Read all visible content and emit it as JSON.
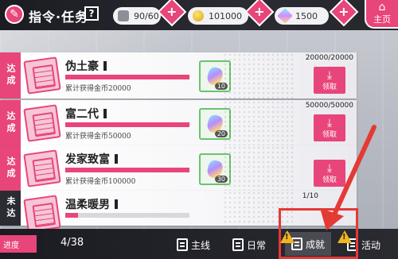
{
  "header": {
    "title": "指令·任务",
    "help_label": "?",
    "resources": {
      "stamina": "90/60",
      "coins": "101000",
      "crystals": "1500"
    },
    "plus_label": "+",
    "home_label": "主页"
  },
  "tasks": [
    {
      "status": "达成",
      "name": "伪土豪",
      "desc": "累计获得金币20000",
      "count": "20000/20000",
      "progress": 1.0,
      "reward_qty": "10",
      "claim_label": "领取"
    },
    {
      "status": "达成",
      "name": "富二代",
      "desc": "累计获得金币50000",
      "count": "50000/50000",
      "progress": 1.0,
      "reward_qty": "20",
      "claim_label": "领取"
    },
    {
      "status": "达成",
      "name": "发家致富",
      "desc": "累计获得金币100000",
      "count": "",
      "progress": 1.0,
      "reward_qty": "30",
      "claim_label": "领取"
    },
    {
      "status": "未达",
      "name": "温柔暖男",
      "desc": "",
      "count": "1/10",
      "progress": 0.1,
      "reward_qty": "",
      "claim_label": ""
    }
  ],
  "footer": {
    "page_tag": "进度",
    "page_count": "4/38",
    "tabs": {
      "main": "主线",
      "daily": "日常",
      "achievement": "成就",
      "event": "活动"
    }
  },
  "colors": {
    "accent": "#e8457a",
    "dark_bar": "#1b1b22",
    "annotation": "#e53935",
    "warning": "#f2b51f"
  }
}
